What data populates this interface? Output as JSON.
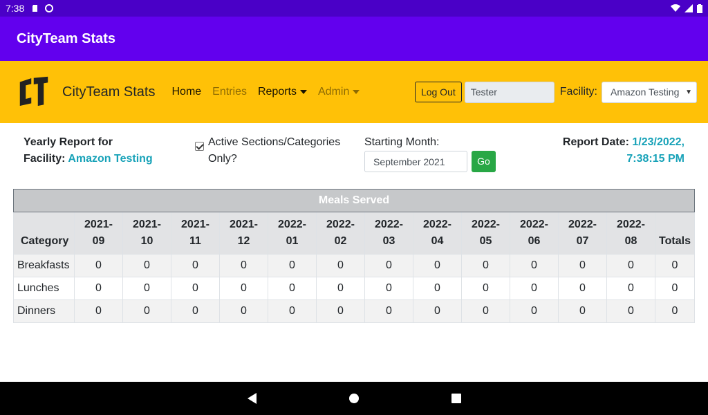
{
  "status_bar": {
    "time": "7:38"
  },
  "app_bar": {
    "title": "CityTeam Stats"
  },
  "navbar": {
    "brand": "CityTeam Stats",
    "links": [
      {
        "label": "Home",
        "muted": false,
        "dropdown": false
      },
      {
        "label": "Entries",
        "muted": true,
        "dropdown": false
      },
      {
        "label": "Reports",
        "muted": false,
        "dropdown": true
      },
      {
        "label": "Admin",
        "muted": true,
        "dropdown": true
      }
    ],
    "logout_label": "Log Out",
    "user_value": "Tester",
    "facility_label": "Facility:",
    "facility_value": "Amazon Testing"
  },
  "report_info": {
    "title_line1": "Yearly Report for",
    "title_line2": "Facility:",
    "facility_name": "Amazon Testing",
    "active_only_line1": "Active Sections/Categories",
    "active_only_line2": "Only?",
    "active_only_checked": true,
    "starting_month_label": "Starting Month:",
    "starting_month_value": "September 2021",
    "go_label": "Go",
    "report_date_label": "Report Date:",
    "report_date_line1": "1/23/2022,",
    "report_date_line2": "7:38:15 PM"
  },
  "table": {
    "caption": "Meals Served",
    "category_header": "Category",
    "months": [
      "2021-09",
      "2021-10",
      "2021-11",
      "2021-12",
      "2022-01",
      "2022-02",
      "2022-03",
      "2022-04",
      "2022-05",
      "2022-06",
      "2022-07",
      "2022-08"
    ],
    "totals_header": "Totals",
    "rows": [
      {
        "category": "Breakfasts",
        "values": [
          0,
          0,
          0,
          0,
          0,
          0,
          0,
          0,
          0,
          0,
          0,
          0
        ],
        "total": 0
      },
      {
        "category": "Lunches",
        "values": [
          0,
          0,
          0,
          0,
          0,
          0,
          0,
          0,
          0,
          0,
          0,
          0
        ],
        "total": 0
      },
      {
        "category": "Dinners",
        "values": [
          0,
          0,
          0,
          0,
          0,
          0,
          0,
          0,
          0,
          0,
          0,
          0
        ],
        "total": 0
      }
    ]
  },
  "colors": {
    "status_bar": "#4a00c7",
    "app_bar": "#6200ee",
    "navbar": "#ffc107",
    "accent": "#17a2b8",
    "go_button": "#28a745"
  }
}
